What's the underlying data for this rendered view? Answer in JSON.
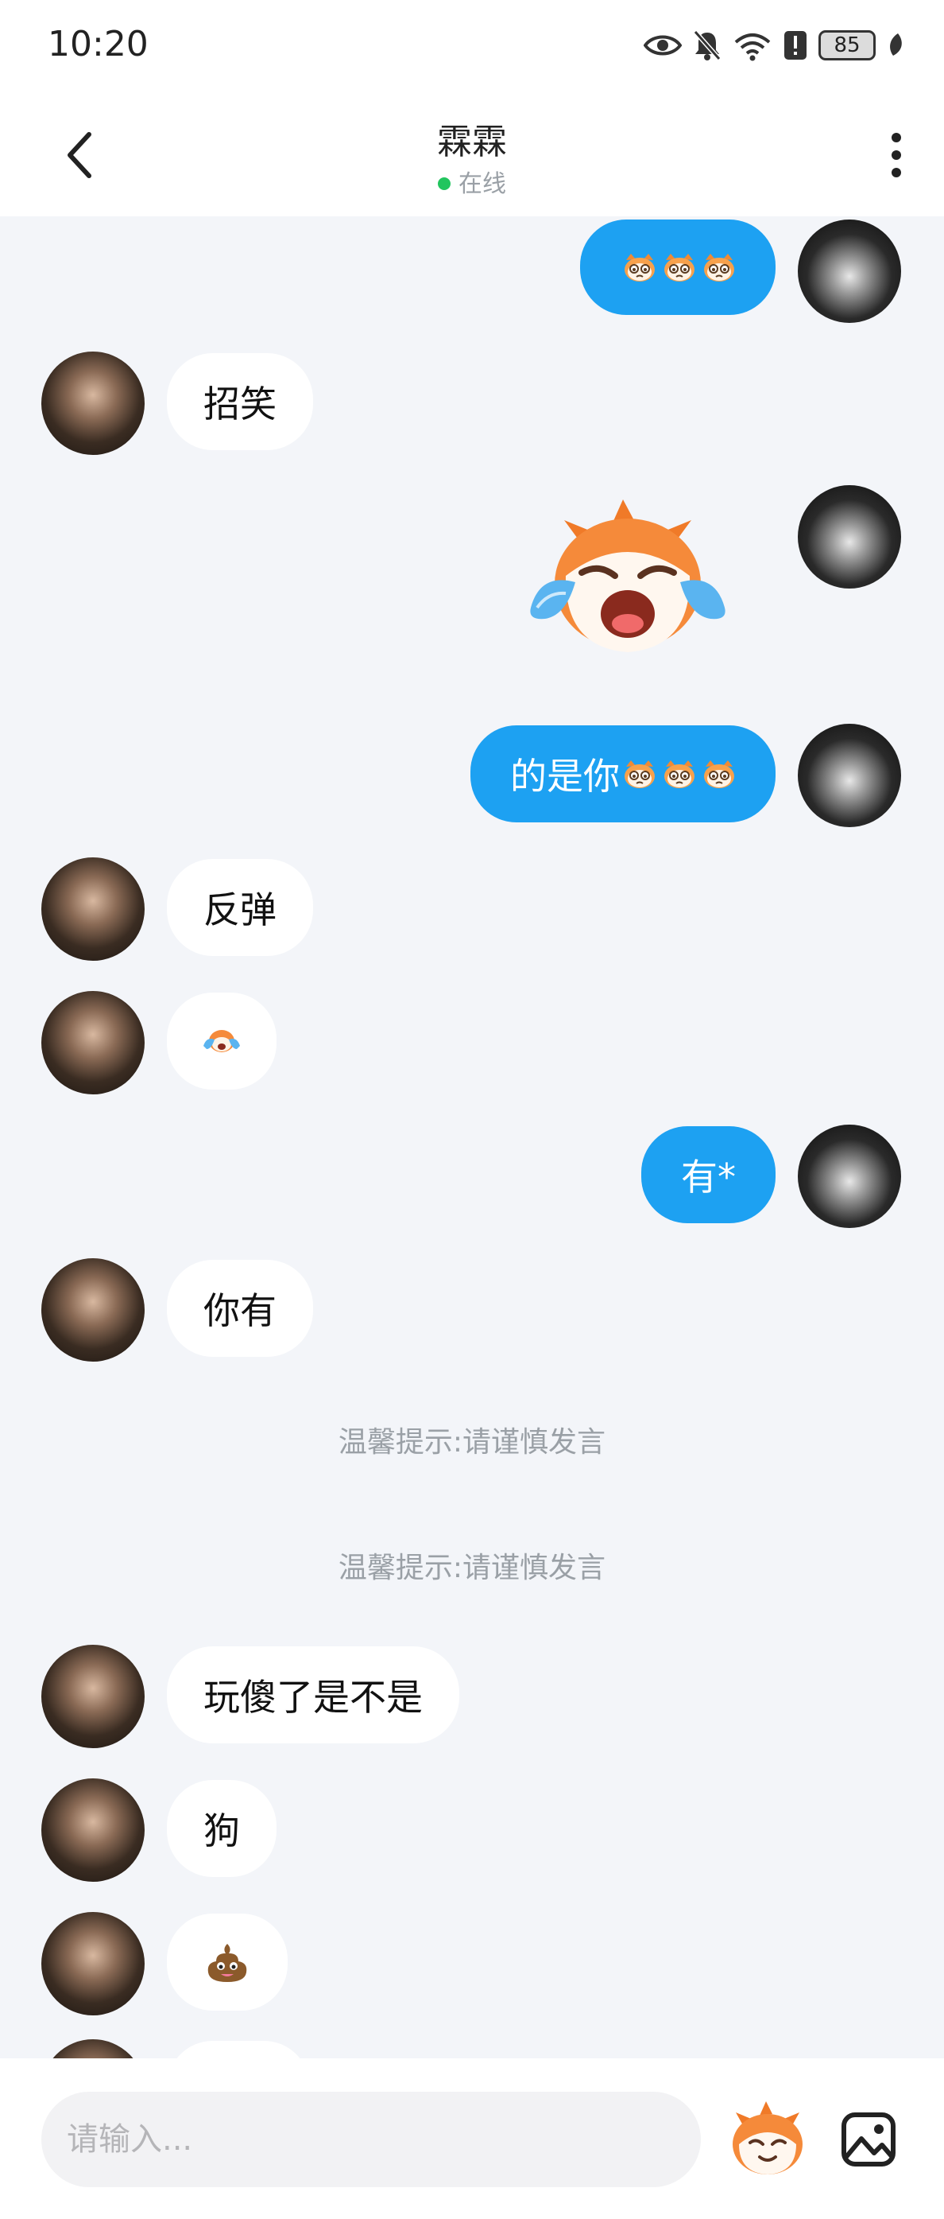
{
  "status_bar": {
    "time": "10:20",
    "battery": "85",
    "icons": [
      "eye-icon",
      "bell-off-icon",
      "wifi-6-icon",
      "alert-icon",
      "battery-icon",
      "leaf-icon"
    ]
  },
  "header": {
    "title": "霖霖",
    "status": "在线",
    "status_color": "#22c55e"
  },
  "messages": [
    {
      "sender": "self",
      "type": "emoji",
      "emoji": [
        "tearful-face",
        "tearful-face",
        "tearful-face"
      ]
    },
    {
      "sender": "peer",
      "type": "text",
      "text": "招笑"
    },
    {
      "sender": "self",
      "type": "sticker",
      "sticker": "crying-cat-sticker"
    },
    {
      "sender": "self",
      "type": "text_emoji",
      "text": "的是你",
      "emoji": [
        "tearful-face",
        "tearful-face",
        "tearful-face"
      ]
    },
    {
      "sender": "peer",
      "type": "text",
      "text": "反弹"
    },
    {
      "sender": "peer",
      "type": "emoji",
      "emoji": [
        "crying-face"
      ]
    },
    {
      "sender": "self",
      "type": "text",
      "text": "有*"
    },
    {
      "sender": "peer",
      "type": "text",
      "text": "你有"
    },
    {
      "sender": "system",
      "type": "tip",
      "text": "温馨提示:请谨慎发言"
    },
    {
      "sender": "system",
      "type": "tip",
      "text": "温馨提示:请谨慎发言"
    },
    {
      "sender": "peer",
      "type": "text",
      "text": "玩傻了是不是"
    },
    {
      "sender": "peer",
      "type": "text",
      "text": "狗"
    },
    {
      "sender": "peer",
      "type": "emoji",
      "emoji": [
        "poop-icon"
      ]
    }
  ],
  "input": {
    "placeholder": "请输入..."
  },
  "colors": {
    "self_bubble": "#1da1f2",
    "peer_bubble": "#ffffff",
    "background": "#f3f5f9"
  }
}
